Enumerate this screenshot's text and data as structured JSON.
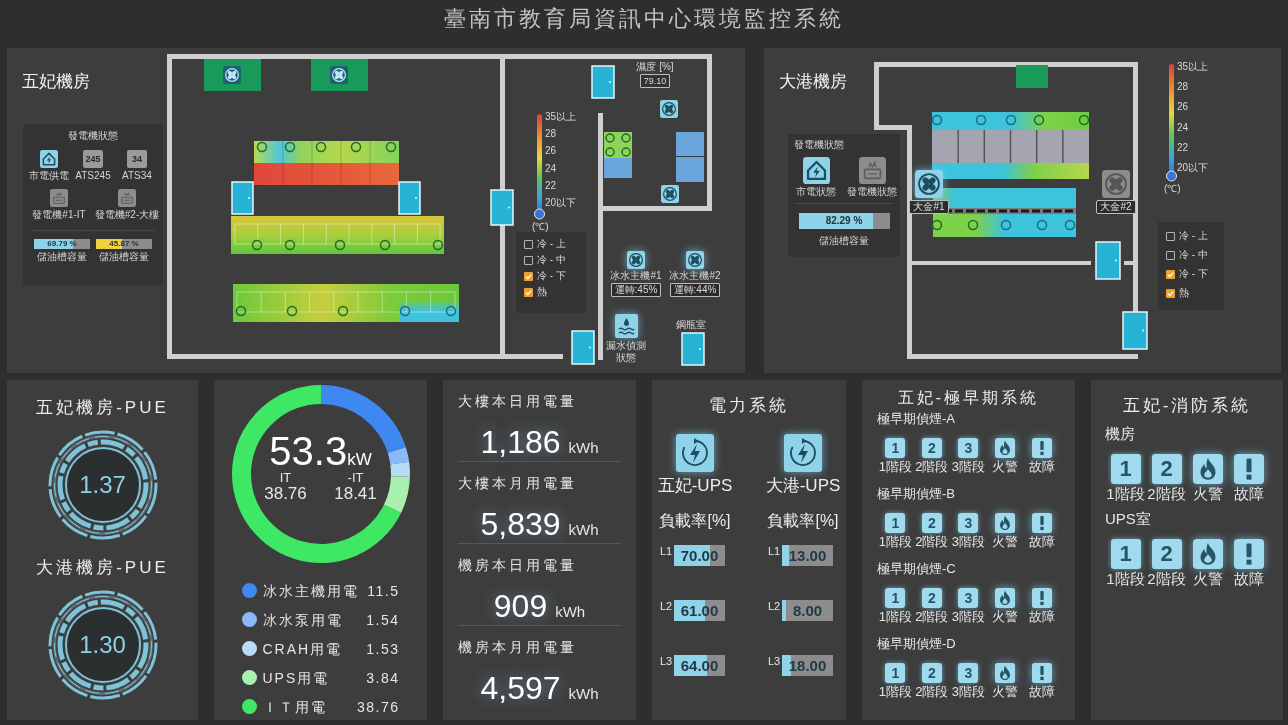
{
  "title": "臺南市教育局資訊中心環境監控系統",
  "floor_plans": [
    {
      "name": "五妃機房",
      "generator_panel": {
        "title": "發電機狀態",
        "status_rows": [
          [
            {
              "kind": "grid",
              "label": "市電供電",
              "on": true
            },
            {
              "kind": "ats",
              "glyph": "245",
              "label": "ATS245",
              "on": false
            },
            {
              "kind": "ats",
              "glyph": "34",
              "label": "ATS34",
              "on": false
            }
          ],
          [
            {
              "kind": "generator",
              "label": "發電機#1-IT",
              "on": false
            },
            {
              "kind": "generator",
              "label": "發電機#2-大樓",
              "on": false
            }
          ]
        ],
        "tanks": [
          {
            "reading": "69.79 %",
            "level": 0.6979,
            "color": "#8fd3ea",
            "label": "儲油槽容量"
          },
          {
            "reading": "45.87 %",
            "level": 0.4587,
            "color": "#f2d23c",
            "label": "儲油槽容量"
          }
        ]
      },
      "humidity": {
        "label": "濕度 [%]",
        "value": "79.10"
      },
      "temperature_scale": {
        "ticks": [
          "35以上",
          "28",
          "26",
          "24",
          "22",
          "20以下"
        ],
        "unit": "(℃)"
      },
      "layers": [
        {
          "label": "冷 - 上",
          "checked": false
        },
        {
          "label": "冷 - 中",
          "checked": false
        },
        {
          "label": "冷 - 下",
          "checked": true
        },
        {
          "label": "熱",
          "checked": true
        }
      ],
      "chillers": [
        {
          "label": "冰水主機#1",
          "status": "運轉:45%",
          "on": true
        },
        {
          "label": "冰水主機#2",
          "status": "運轉:44%",
          "on": true
        }
      ],
      "leak_sensor": {
        "label": "漏水偵測狀態"
      },
      "gas_room": {
        "label": "鋼瓶室"
      }
    },
    {
      "name": "大港機房",
      "generator_panel": {
        "title": "發電機狀態",
        "status_rows": [
          [
            {
              "kind": "grid",
              "label": "市電狀態",
              "on": true
            },
            {
              "kind": "generator",
              "label": "發電機狀態",
              "on": false
            }
          ]
        ],
        "tanks": [
          {
            "reading": "82.29 %",
            "level": 0.8229,
            "color": "#8fd3ea",
            "label": "儲油槽容量"
          }
        ]
      },
      "fans": [
        {
          "label": "大金#1",
          "on": true
        },
        {
          "label": "大金#2",
          "on": false
        }
      ],
      "temperature_scale": {
        "ticks": [
          "35以上",
          "28",
          "26",
          "24",
          "22",
          "20以下"
        ],
        "unit": "(℃)"
      },
      "layers": [
        {
          "label": "冷 - 上",
          "checked": false
        },
        {
          "label": "冷 - 中",
          "checked": false
        },
        {
          "label": "冷 - 下",
          "checked": true
        },
        {
          "label": "熱",
          "checked": true
        }
      ]
    }
  ],
  "pue": [
    {
      "title": "五妃機房-PUE",
      "value": "1.37"
    },
    {
      "title": "大港機房-PUE",
      "value": "1.30"
    }
  ],
  "power_usage": {
    "total": "53.3",
    "unit": "kW",
    "split": [
      {
        "label": "IT",
        "value": "38.76"
      },
      {
        "label": "-IT",
        "value": "18.41"
      }
    ],
    "chart_data": {
      "type": "donut",
      "categories": [
        "冰水主機用電",
        "冰水泵用電",
        "CRAH用電",
        "UPS用電",
        "ＩＴ用電"
      ],
      "values": [
        20.12,
        2.69,
        2.68,
        6.72,
        67.79
      ],
      "legend": "bottom"
    },
    "legend_items": [
      {
        "value": "11.5",
        "color": "#3f88f2"
      },
      {
        "value": "1.54",
        "color": "#8ab9f7"
      },
      {
        "value": "1.53",
        "color": "#b8dcf8"
      },
      {
        "value": "3.84",
        "color": "#a9efaf"
      },
      {
        "value": "38.76",
        "color": "#3ee865"
      }
    ]
  },
  "energy": [
    {
      "label": "大樓本日用電量",
      "value": "1,186",
      "unit": "kWh"
    },
    {
      "label": "大樓本月用電量",
      "value": "5,839",
      "unit": "kWh"
    },
    {
      "label": "機房本日用電量",
      "value": "909",
      "unit": "kWh"
    },
    {
      "label": "機房本月用電量",
      "value": "4,597",
      "unit": "kWh"
    }
  ],
  "power_system": {
    "title": "電力系統",
    "ups": [
      {
        "name": "五妃-UPS",
        "load_label": "負載率[%]",
        "phases": [
          {
            "label": "L1",
            "reading": "70.00",
            "level": 0.7
          },
          {
            "label": "L2",
            "reading": "61.00",
            "level": 0.61
          },
          {
            "label": "L3",
            "reading": "64.00",
            "level": 0.64
          }
        ]
      },
      {
        "name": "大港-UPS",
        "load_label": "負載率[%]",
        "phases": [
          {
            "label": "L1",
            "reading": "13.00",
            "level": 0.13
          },
          {
            "label": "L2",
            "reading": "8.00",
            "level": 0.08
          },
          {
            "label": "L3",
            "reading": "18.00",
            "level": 0.18
          }
        ]
      }
    ]
  },
  "early_warning": {
    "title": "五妃-極早期系統",
    "groups": [
      {
        "name": "極早期偵煙-A",
        "indicators": [
          {
            "kind": "stage",
            "glyph": "1",
            "label": "1階段"
          },
          {
            "kind": "stage",
            "glyph": "2",
            "label": "2階段"
          },
          {
            "kind": "stage",
            "glyph": "3",
            "label": "3階段"
          },
          {
            "kind": "fire",
            "label": "火警"
          },
          {
            "kind": "fault",
            "label": "故障"
          }
        ]
      },
      {
        "name": "極早期偵煙-B",
        "indicators": [
          {
            "kind": "stage",
            "glyph": "1",
            "label": "1階段"
          },
          {
            "kind": "stage",
            "glyph": "2",
            "label": "2階段"
          },
          {
            "kind": "stage",
            "glyph": "3",
            "label": "3階段"
          },
          {
            "kind": "fire",
            "label": "火警"
          },
          {
            "kind": "fault",
            "label": "故障"
          }
        ]
      },
      {
        "name": "極早期偵煙-C",
        "indicators": [
          {
            "kind": "stage",
            "glyph": "1",
            "label": "1階段"
          },
          {
            "kind": "stage",
            "glyph": "2",
            "label": "2階段"
          },
          {
            "kind": "stage",
            "glyph": "3",
            "label": "3階段"
          },
          {
            "kind": "fire",
            "label": "火警"
          },
          {
            "kind": "fault",
            "label": "故障"
          }
        ]
      },
      {
        "name": "極早期偵煙-D",
        "indicators": [
          {
            "kind": "stage",
            "glyph": "1",
            "label": "1階段"
          },
          {
            "kind": "stage",
            "glyph": "2",
            "label": "2階段"
          },
          {
            "kind": "stage",
            "glyph": "3",
            "label": "3階段"
          },
          {
            "kind": "fire",
            "label": "火警"
          },
          {
            "kind": "fault",
            "label": "故障"
          }
        ]
      }
    ]
  },
  "fire_system": {
    "title": "五妃-消防系統",
    "groups": [
      {
        "name": "機房",
        "indicators": [
          {
            "kind": "stage",
            "glyph": "1",
            "label": "1階段"
          },
          {
            "kind": "stage",
            "glyph": "2",
            "label": "2階段"
          },
          {
            "kind": "fire",
            "label": "火警"
          },
          {
            "kind": "fault",
            "label": "故障"
          }
        ]
      },
      {
        "name": "UPS室",
        "indicators": [
          {
            "kind": "stage",
            "glyph": "1",
            "label": "1階段"
          },
          {
            "kind": "stage",
            "glyph": "2",
            "label": "2階段"
          },
          {
            "kind": "fire",
            "label": "火警"
          },
          {
            "kind": "fault",
            "label": "故障"
          }
        ]
      }
    ]
  }
}
